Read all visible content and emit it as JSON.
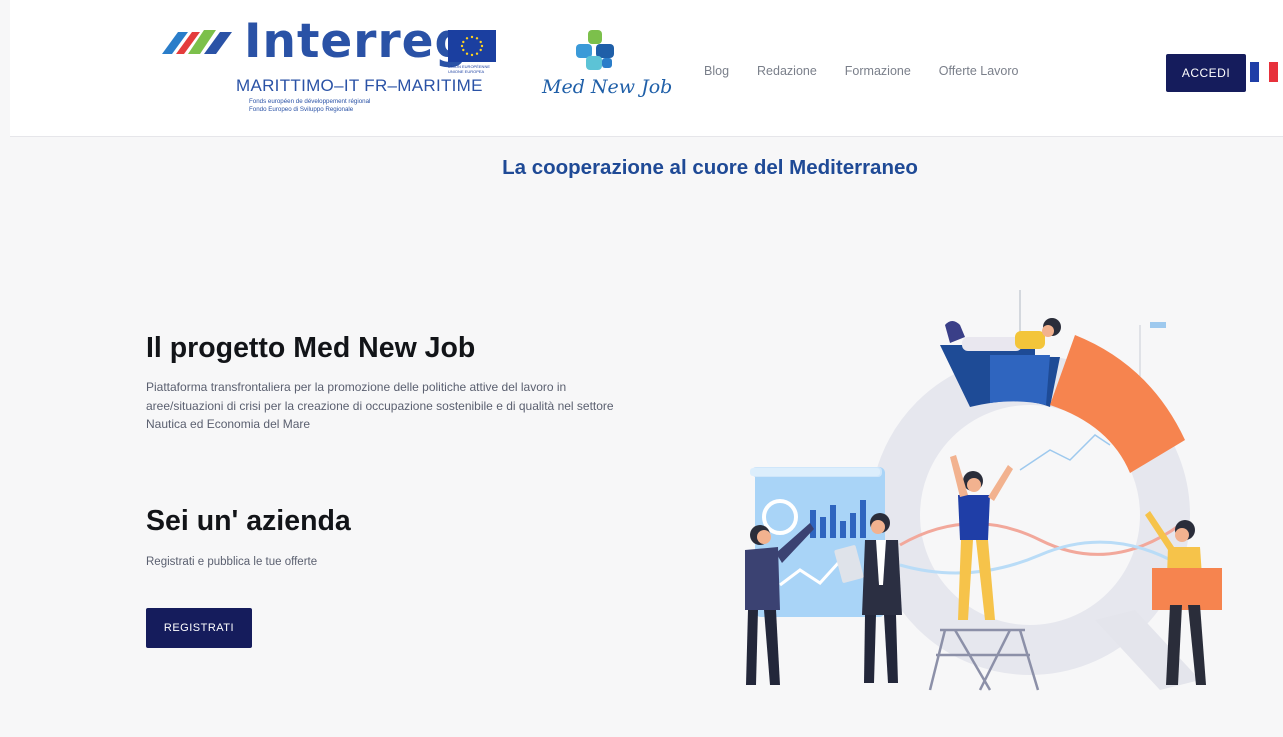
{
  "header": {
    "interreg": {
      "wordmark": "Interreg",
      "programme": "MARITTIMO–IT FR–MARITIME",
      "fund_fr": "Fonds européen de développement régional",
      "fund_it": "Fondo Europeo di Sviluppo Regionale",
      "eu_label_fr": "UNION EUROPÉENNE",
      "eu_label_it": "UNIONE EUROPEA"
    },
    "brand": "Med New Job",
    "nav": [
      {
        "label": "Blog"
      },
      {
        "label": "Redazione"
      },
      {
        "label": "Formazione"
      },
      {
        "label": "Offerte Lavoro"
      }
    ],
    "login_label": "ACCEDI",
    "language_flag": "flag-fr-icon"
  },
  "hero": {
    "tagline": "La cooperazione al cuore del Mediterraneo",
    "project_title": "Il progetto Med New Job",
    "project_description": "Piattaforma transfrontaliera per la promozione delle politiche attive del lavoro in aree/situazioni di crisi per la creazione di occupazione sostenibile e di qualità nel settore Nautica ed Economia del Mare",
    "company_title": "Sei un' azienda",
    "company_subtitle": "Registrati e pubblica le tue offerte",
    "register_label": "REGISTRATI"
  },
  "colors": {
    "primary": "#151c5c",
    "heading_blue": "#1f4a96",
    "brand_blue": "#2a52a6",
    "accent_orange": "#f6844f",
    "flag_blue": "#1f3ea7",
    "flag_red": "#e7313b"
  }
}
